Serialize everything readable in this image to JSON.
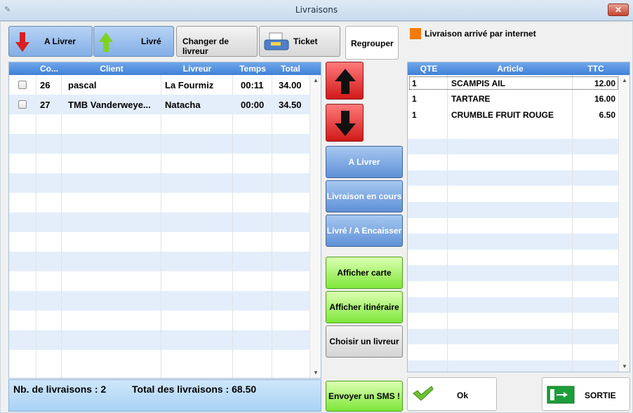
{
  "window": {
    "title": "Livraisons"
  },
  "toolbar": {
    "a_livrer": "A Livrer",
    "livre": "Livré",
    "changer_livreur": "Changer de livreur",
    "ticket": "Ticket",
    "regrouper": "Regrouper"
  },
  "legend": {
    "text": "Livraison arrivé par internet",
    "color": "#f57c00"
  },
  "deliveries": {
    "columns": [
      "Co...",
      "Client",
      "Livreur",
      "Temps",
      "Total"
    ],
    "rows": [
      {
        "co": "26",
        "client": "pascal",
        "livreur": "La Fourmiz",
        "temps": "00:11",
        "total": "34.00"
      },
      {
        "co": "27",
        "client": "TMB Vanderweye...",
        "livreur": "Natacha",
        "temps": "00:00",
        "total": "34.50"
      }
    ]
  },
  "middle": {
    "a_livrer": "A Livrer",
    "en_cours": "Livraison en cours",
    "livre_encaisser": "Livré / A Encaisser",
    "afficher_carte": "Afficher carte",
    "afficher_itineraire": "Afficher itinéraire",
    "choisir_livreur": "Choisir un livreur",
    "envoyer_sms": "Envoyer un SMS !"
  },
  "articles": {
    "columns": [
      "QTE",
      "Article",
      "TTC"
    ],
    "rows": [
      {
        "qte": "1",
        "article": "SCAMPIS AIL",
        "ttc": "12.00"
      },
      {
        "qte": "1",
        "article": "TARTARE",
        "ttc": "16.00"
      },
      {
        "qte": "1",
        "article": "CRUMBLE FRUIT ROUGE",
        "ttc": "6.50"
      }
    ]
  },
  "footer": {
    "nb_livraisons": "Nb. de livraisons : 2",
    "total_livraisons": "Total des livraisons : 68.50"
  },
  "actions": {
    "ok": "Ok",
    "sortie": "SORTIE"
  }
}
